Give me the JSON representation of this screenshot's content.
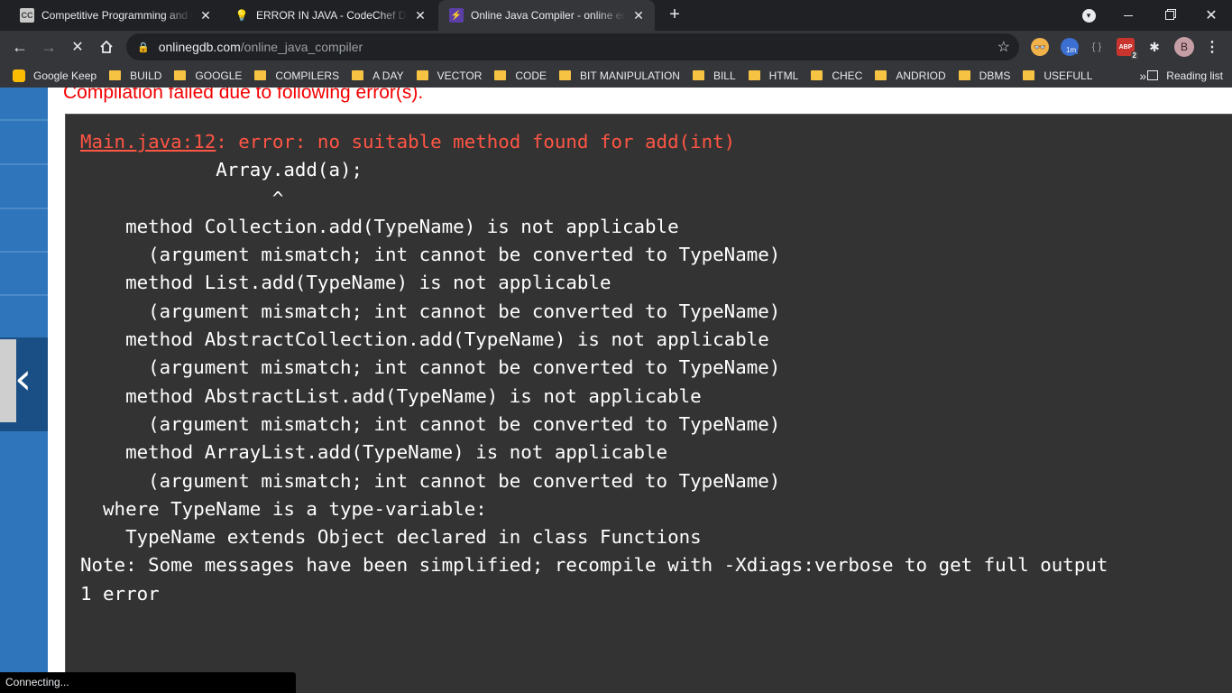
{
  "tabs": [
    {
      "title": "Competitive Programming and C",
      "favicon": "CC",
      "close": "✕"
    },
    {
      "title": "ERROR IN JAVA - CodeChef Discu",
      "favicon": "💡",
      "close": "✕"
    },
    {
      "title": "Online Java Compiler - online ed",
      "favicon": "⚡",
      "close": "✕"
    }
  ],
  "toolbar": {
    "url_host": "onlinegdb.com",
    "url_path": "/online_java_compiler"
  },
  "bookmarks": {
    "items": [
      "Google Keep",
      "BUILD",
      "GOOGLE",
      "COMPILERS",
      "A DAY",
      "VECTOR",
      "CODE",
      "BIT MANIPULATION",
      "BILL",
      "HTML",
      "CHEC",
      "ANDRIOD",
      "DBMS",
      "USEFULL"
    ],
    "overflow": "»",
    "reading_list": "Reading list"
  },
  "page": {
    "error_heading": "Compilation failed due to following error(s).",
    "error_location": "Main.java:12",
    "error_message": ": error: no suitable method found for add(int)",
    "output_lines": [
      "            Array.add(a);",
      "                 ^",
      "    method Collection.add(TypeName) is not applicable",
      "      (argument mismatch; int cannot be converted to TypeName)",
      "    method List.add(TypeName) is not applicable",
      "      (argument mismatch; int cannot be converted to TypeName)",
      "    method AbstractCollection.add(TypeName) is not applicable",
      "      (argument mismatch; int cannot be converted to TypeName)",
      "    method AbstractList.add(TypeName) is not applicable",
      "      (argument mismatch; int cannot be converted to TypeName)",
      "    method ArrayList.add(TypeName) is not applicable",
      "      (argument mismatch; int cannot be converted to TypeName)",
      "  where TypeName is a type-variable:",
      "    TypeName extends Object declared in class Functions",
      "Note: Some messages have been simplified; recompile with -Xdiags:verbose to get full output",
      "1 error"
    ]
  },
  "status_text": "Connecting...",
  "profile_initial": "B",
  "extensions": {
    "abp_count": "2",
    "timer_label": "1m"
  },
  "colors": {
    "error_red": "#f20000",
    "console_bg": "#333333",
    "sidebar_blue": "#2f75bb"
  }
}
